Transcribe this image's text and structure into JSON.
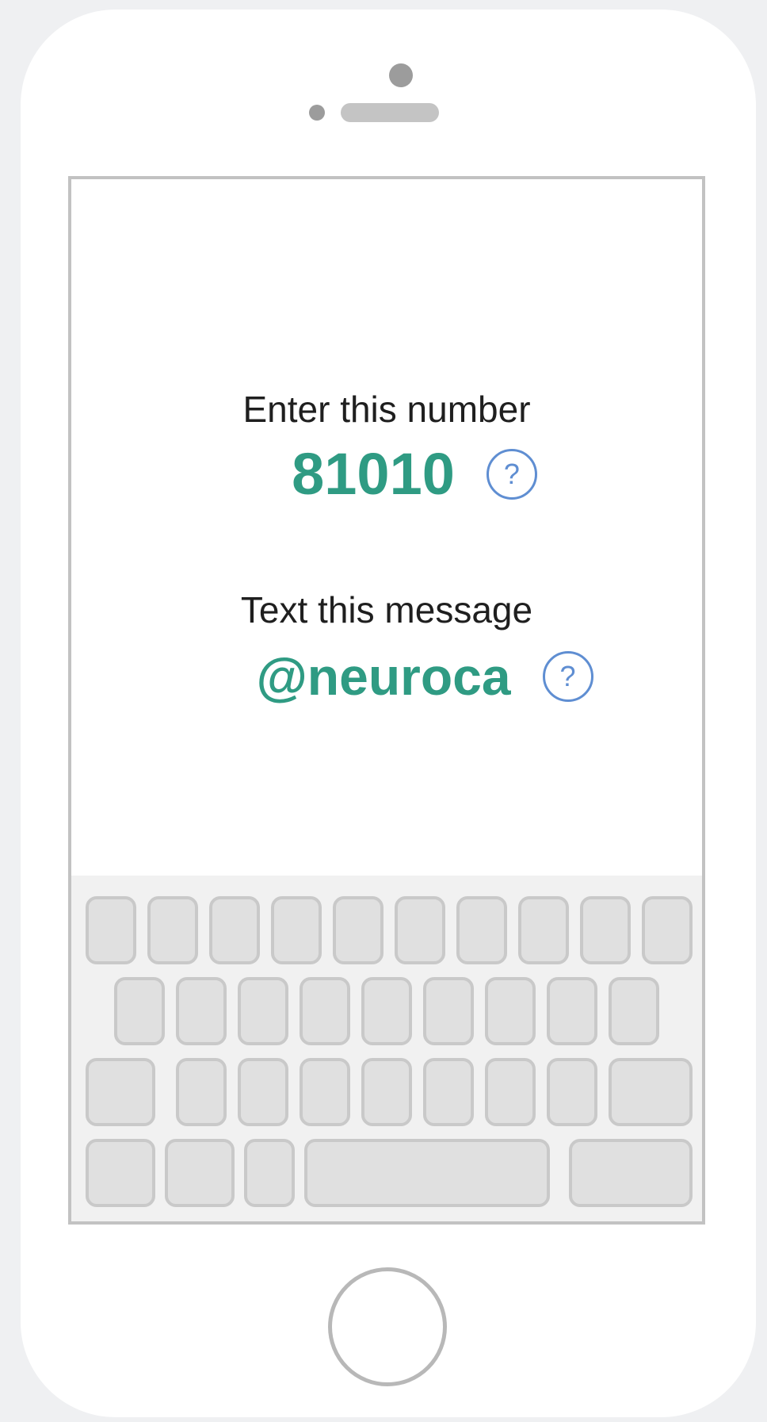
{
  "prompt_number": {
    "label": "Enter this number",
    "value": "81010",
    "help_icon": "?"
  },
  "prompt_message": {
    "label": "Text this message",
    "value": "@neuroca",
    "help_icon": "?"
  },
  "colors": {
    "accent_value": "#2f9b83",
    "help_icon": "#5f8ed2"
  }
}
